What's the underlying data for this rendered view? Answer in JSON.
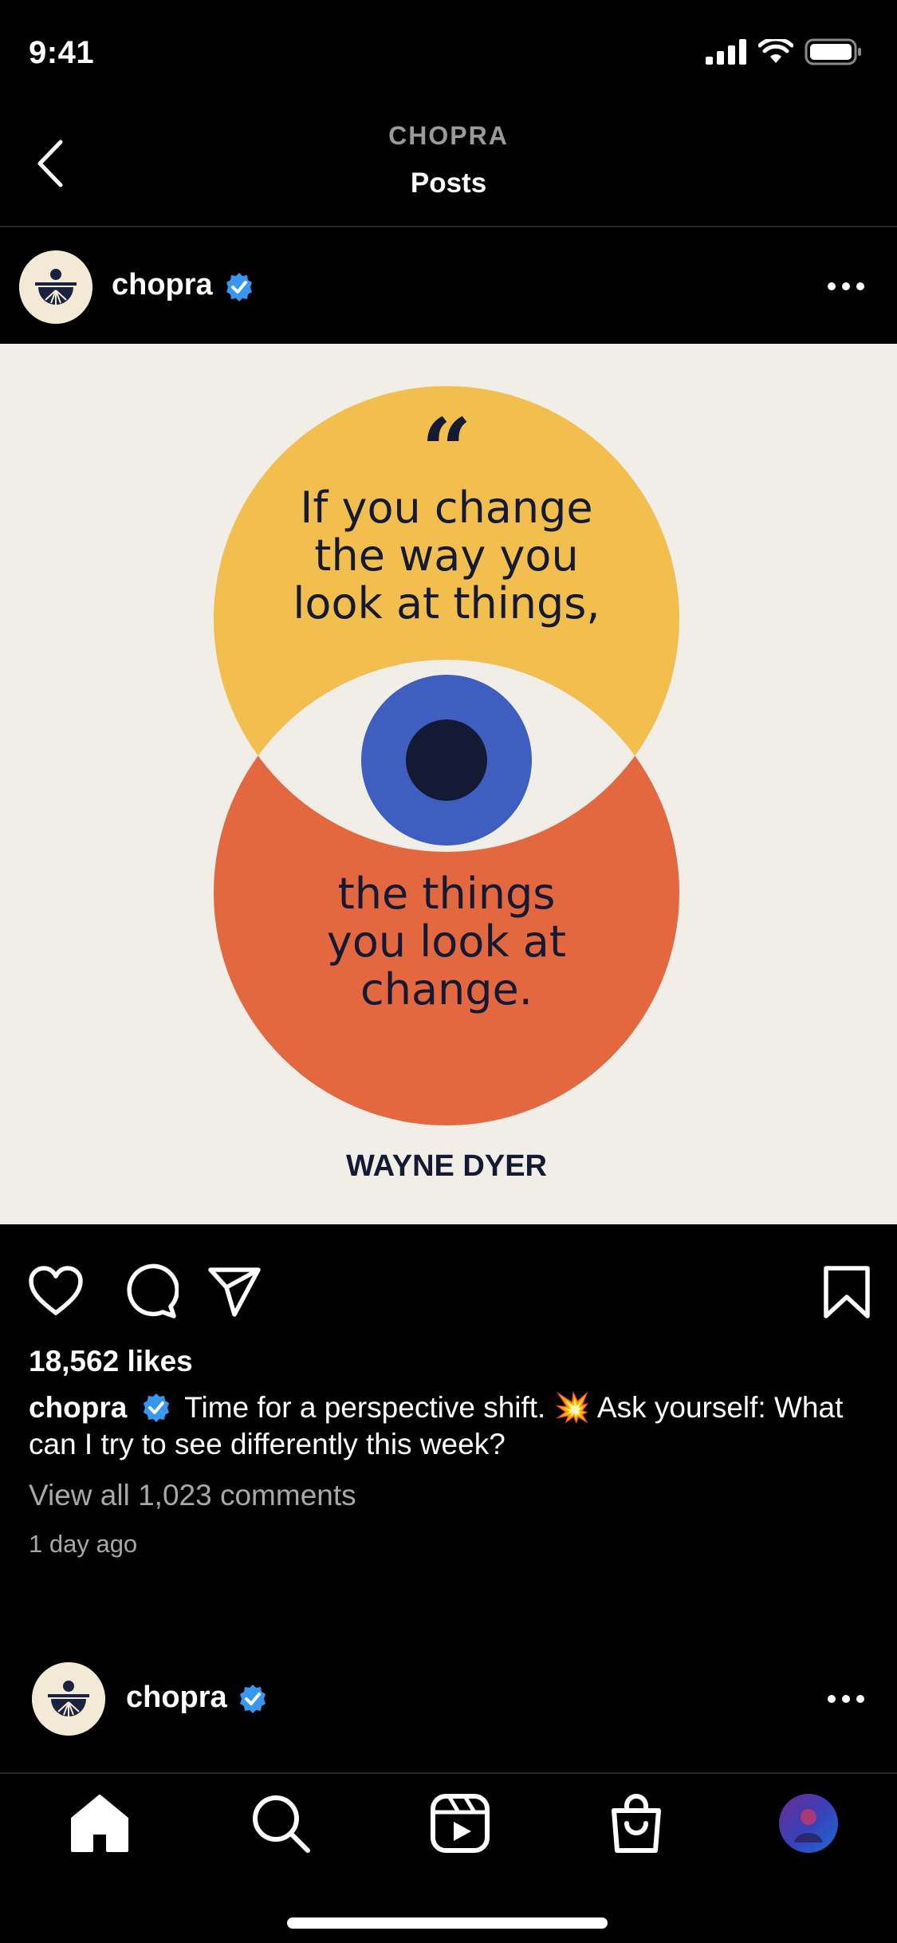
{
  "status_bar": {
    "time": "9:41"
  },
  "header": {
    "account": "CHOPRA",
    "title": "Posts"
  },
  "post": {
    "username": "chopra",
    "image": {
      "quote_mark": "“",
      "quote_top": [
        "If you change",
        "the way you",
        "look at things,"
      ],
      "quote_bottom": [
        "the things",
        "you look at",
        "change."
      ],
      "author": "WAYNE DYER"
    },
    "likes": "18,562 likes",
    "caption_user": "chopra",
    "caption_text": "Time for a perspective shift. 💥 Ask yourself: What can I try to see differently this week?",
    "comments_link": "View all 1,023 comments",
    "time_ago": "1 day ago"
  },
  "next_post": {
    "username": "chopra"
  },
  "colors": {
    "background": "#000000",
    "verified_blue": "#3897f0",
    "image_background": "#f1eee8",
    "circle_yellow": "#f2be4e",
    "circle_orange": "#e3673f",
    "iris_blue": "#3f5fc0",
    "ink_navy": "#141a33"
  },
  "icons": [
    "back-chevron-icon",
    "verified-icon",
    "more-icon",
    "heart-icon",
    "comment-icon",
    "share-icon",
    "bookmark-icon",
    "home-icon",
    "search-icon",
    "reels-icon",
    "shop-icon",
    "profile-avatar-icon"
  ]
}
